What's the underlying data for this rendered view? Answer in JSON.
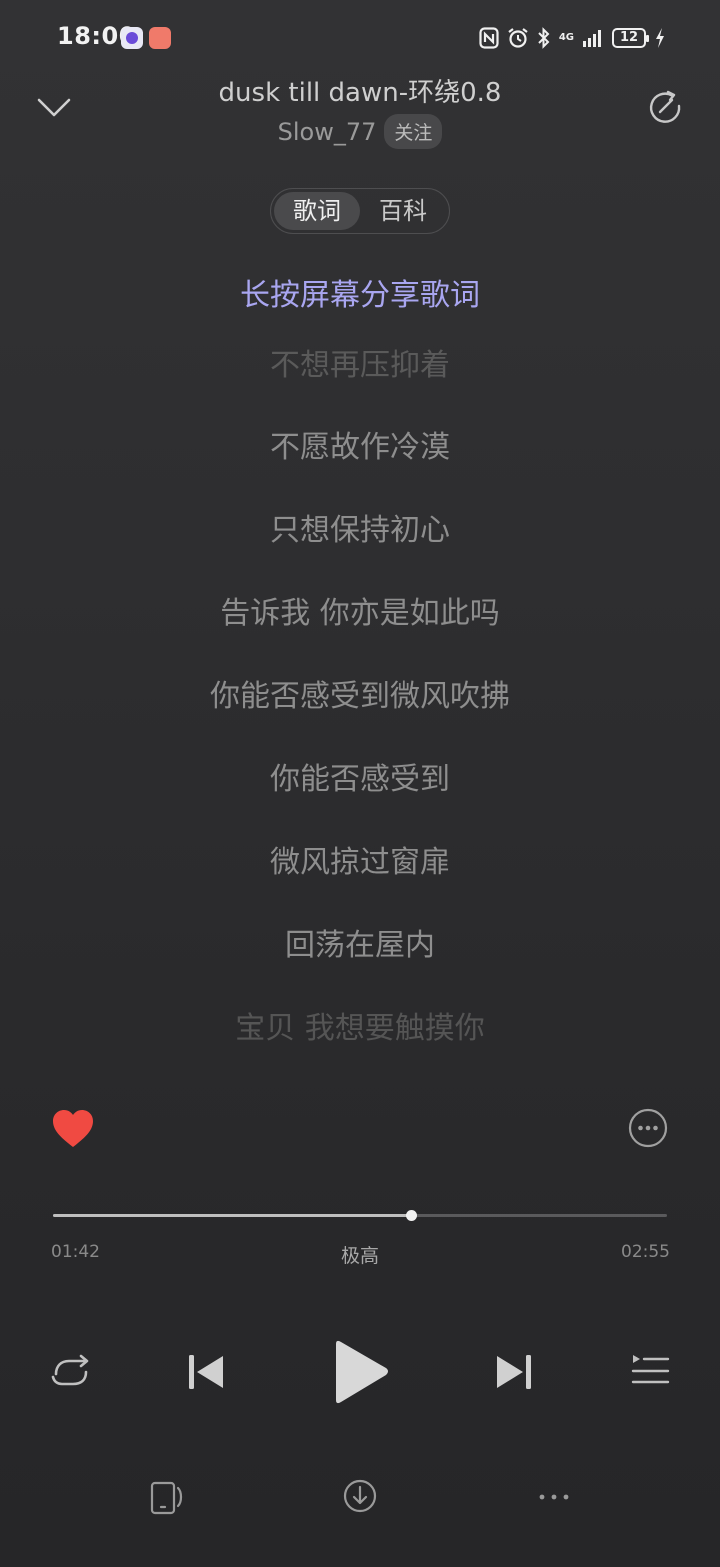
{
  "status_bar": {
    "time": "18:00",
    "network": "4G",
    "battery": "12"
  },
  "header": {
    "title": "dusk till dawn-环绕0.8",
    "artist": "Slow_77",
    "follow_label": "关注",
    "icons": [
      "chevron-down-icon",
      "share-icon"
    ]
  },
  "tabs": [
    {
      "label": "歌词",
      "active": true
    },
    {
      "label": "百科",
      "active": false
    }
  ],
  "share_hint": "长按屏幕分享歌词",
  "lyrics": {
    "partial_top": "不想再压抑着",
    "lines": [
      "不愿故作冷漠",
      "只想保持初心",
      "告诉我 你亦是如此吗",
      "你能否感受到微风吹拂",
      "你能否感受到",
      "微风掠过窗扉",
      "回荡在屋内"
    ],
    "faded_bottom": "宝贝 我想要触摸你"
  },
  "playback": {
    "current_time": "01:42",
    "total_time": "02:55",
    "quality": "极高",
    "progress": 0.583,
    "liked": true
  },
  "controls": {
    "icons": [
      "repeat-icon",
      "previous-icon",
      "play-icon",
      "next-icon",
      "playlist-icon"
    ]
  },
  "bottom_bar": {
    "icons": [
      "device-icon",
      "download-icon",
      "more-dots-icon"
    ]
  },
  "colors": {
    "accent": "#a9a6f0",
    "like": "#f04a42",
    "background": "#2e2e30"
  }
}
